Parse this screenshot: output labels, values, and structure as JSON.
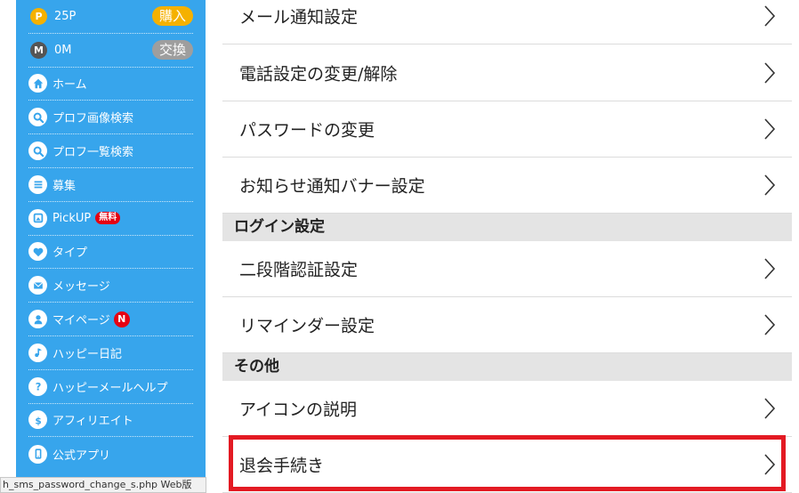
{
  "sidebar": {
    "points": {
      "coin": "P",
      "amount": "25P",
      "button": "購入"
    },
    "mileage": {
      "coin": "M",
      "amount": "0M",
      "button": "交換"
    },
    "items": [
      {
        "label": "ホーム",
        "icon": "home-icon"
      },
      {
        "label": "プロフ画像検索",
        "icon": "search-icon"
      },
      {
        "label": "プロフ一覧検索",
        "icon": "search-icon"
      },
      {
        "label": "募集",
        "icon": "list-icon"
      },
      {
        "label": "PickUP",
        "icon": "photo-icon",
        "badge": "無料"
      },
      {
        "label": "タイプ",
        "icon": "heart-icon"
      },
      {
        "label": "メッセージ",
        "icon": "mail-icon"
      },
      {
        "label": "マイページ",
        "icon": "person-icon",
        "badge": "N"
      },
      {
        "label": "ハッピー日記",
        "icon": "music-note-icon"
      },
      {
        "label": "ハッピーメールヘルプ",
        "icon": "question-icon"
      },
      {
        "label": "アフィリエイト",
        "icon": "dollar-icon"
      },
      {
        "label": "公式アプリ",
        "icon": "smartphone-icon"
      }
    ]
  },
  "status_bar": {
    "text": "h_sms_password_change_s.php",
    "suffix": "Web版"
  },
  "settings": {
    "rows_top": [
      "メール通知設定",
      "電話設定の変更/解除",
      "パスワードの変更",
      "お知らせ通知バナー設定"
    ],
    "section_login": "ログイン設定",
    "rows_login": [
      "二段階認証設定",
      "リマインダー設定"
    ],
    "section_other": "その他",
    "rows_other": [
      "アイコンの説明",
      "退会手続き"
    ]
  },
  "colors": {
    "sidebar_bg": "#37a5ec",
    "highlight": "#e31a23",
    "section_bg": "#e4e4e4",
    "points_coin": "#f5b100",
    "badge_red": "#e60012"
  }
}
